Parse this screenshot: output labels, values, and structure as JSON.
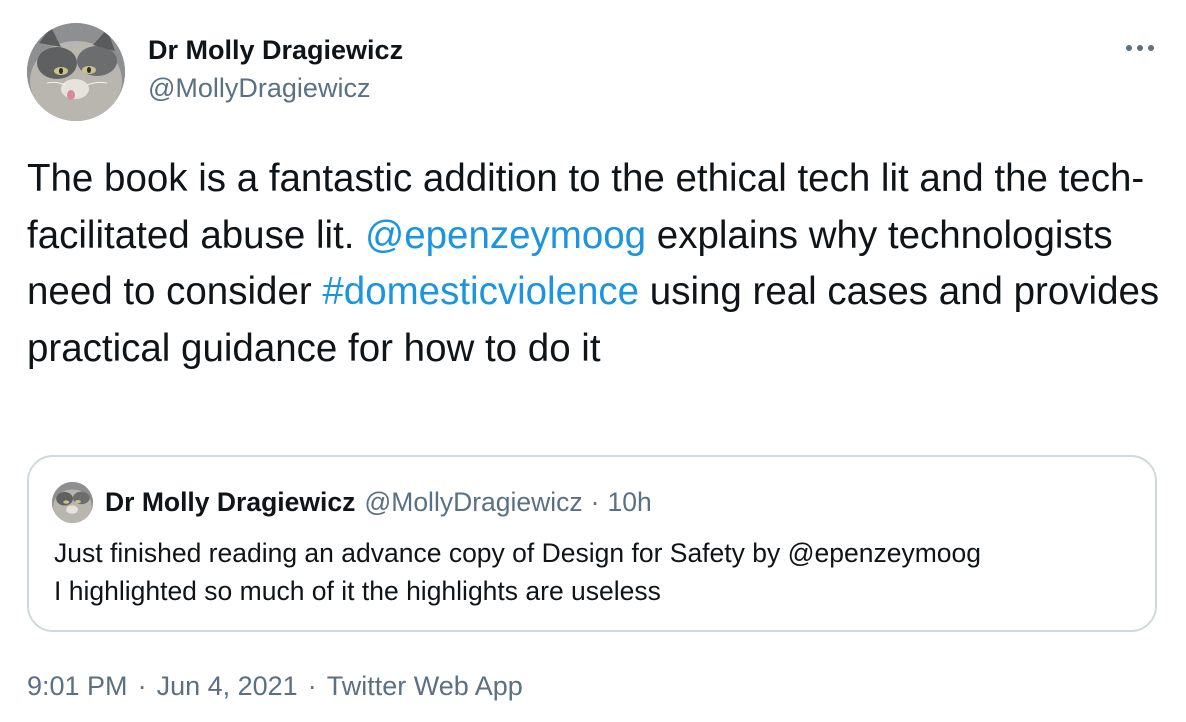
{
  "tweet": {
    "author": {
      "display_name": "Dr Molly Dragiewicz",
      "handle": "@MollyDragiewicz",
      "avatar_icon": "cat-avatar-icon"
    },
    "more_icon": "more-options-icon",
    "text_parts": [
      "The book is a fantastic addition to the ethical tech lit and the tech-facilitated abuse lit. ",
      "@epenzeymoog",
      " explains why technologists need to consider ",
      "#domesticviolence",
      " using real cases and provides practical guidance for how to do it"
    ],
    "quoted": {
      "display_name": "Dr Molly Dragiewicz",
      "handle": "@MollyDragiewicz",
      "separator": "·",
      "time": "10h",
      "text_line1": "Just finished reading an advance copy of Design for Safety by @epenzeymoog",
      "text_line2": "I highlighted so much of it the highlights are useless"
    },
    "meta": {
      "time": "9:01 PM",
      "separator": "·",
      "date": "Jun 4, 2021",
      "source": "Twitter Web App"
    }
  },
  "colors": {
    "text": "#0f1419",
    "secondary": "#5b7083",
    "link": "#1b95e0",
    "border": "#cfd9de"
  }
}
